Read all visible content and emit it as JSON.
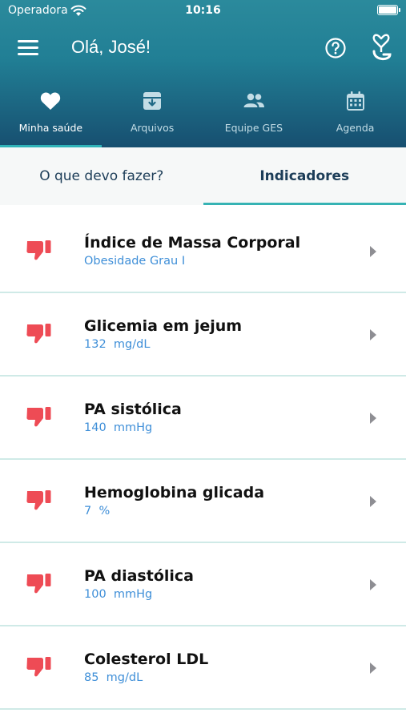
{
  "status_bar": {
    "carrier": "Operadora",
    "time": "10:16"
  },
  "header": {
    "greeting": "Olá, José!"
  },
  "tabs": [
    {
      "label": "Minha saúde",
      "icon": "heart-icon"
    },
    {
      "label": "Arquivos",
      "icon": "archive-icon"
    },
    {
      "label": "Equipe GES",
      "icon": "group-icon"
    },
    {
      "label": "Agenda",
      "icon": "calendar-icon"
    }
  ],
  "subtabs": {
    "left": "O que devo fazer?",
    "right": "Indicadores"
  },
  "indicators": [
    {
      "title": "Índice de Massa Corporal",
      "value": "Obesidade Grau I"
    },
    {
      "title": "Glicemia em jejum",
      "value": "132  mg/dL"
    },
    {
      "title": "PA sistólica",
      "value": "140  mmHg"
    },
    {
      "title": "Hemoglobina glicada",
      "value": "7  %"
    },
    {
      "title": "PA diastólica",
      "value": "100  mmHg"
    },
    {
      "title": "Colesterol LDL",
      "value": "85  mg/dL"
    }
  ],
  "colors": {
    "accent": "#36b3b4",
    "bad_indicator": "#ee4b55",
    "value_text": "#3f8fd8",
    "header_top": "#2b8a9c",
    "header_bottom": "#174f70"
  }
}
